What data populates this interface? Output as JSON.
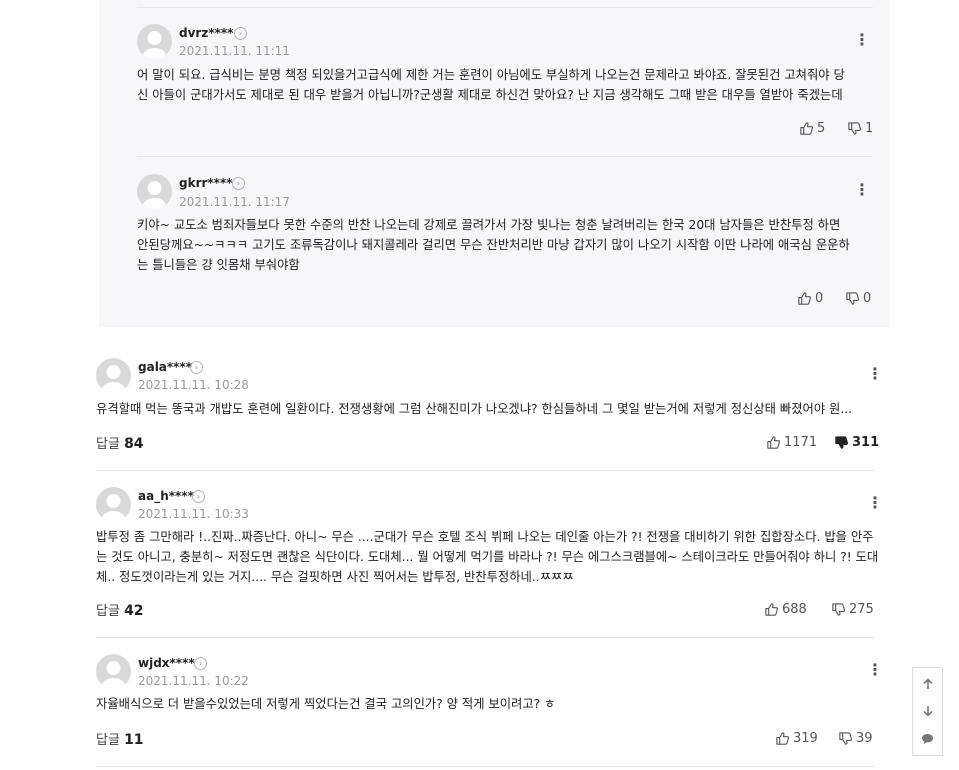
{
  "replies": [
    {
      "username": "dvrz****",
      "date": "2021.11.11. 11:11",
      "lines": [
        "어 말이 되요. 급식비는 분명 책정 되있을거고급식에 제한 거는 훈련이 아님에도 부실하게 나오는건 문제라고 봐야죠. 잘못된건 고쳐줘야 당",
        "신 아들이 군대가서도 제대로 된 대우 받을거 아닙니까?군생활 제대로 하신건 맞아요? 난 지금 생각해도 그때 받은 대우들 열받아 죽겠는데"
      ],
      "likes": "5",
      "dislikes": "1"
    },
    {
      "username": "gkrr****",
      "date": "2021.11.11. 11:17",
      "lines": [
        "키야~ 교도소 범죄자들보다 못한 수준의 반찬 나오는데 강제로 끌려가서 가장 빛나는 청춘 날려버리는 한국 20대 남자들은 반찬투정 하면",
        "안된당께요~~ㅋㅋㅋ 고기도 조류독감이나 돼지콜레라 걸리면 무슨 잔반처리반 마냥 갑자기 많이 나오기 시작함 이딴 나라에 애국심 운운하",
        "는 틀니들은 걍 잇몸채 부숴야함"
      ],
      "likes": "0",
      "dislikes": "0"
    }
  ],
  "comments": [
    {
      "username": "gala****",
      "date": "2021.11.11. 10:28",
      "lines": [
        "유격할때 먹는 똥국과 개밥도 훈련에 일환이다. 전쟁생황에 그럼 산해진미가 나오겠냐? 한심들하네 그 몇일 받는거에 저렇게 정신상태 빠졌어야 원..."
      ],
      "reply_label": "답글",
      "reply_count": "84",
      "likes": "1171",
      "dislikes": "311"
    },
    {
      "username": "aa_h****",
      "date": "2021.11.11. 10:33",
      "lines": [
        "밥투정 좀 그만해라 !..진짜..짜증난다. 아니~ 무슨 ....군대가 무슨 호텔 조식 뷔페 나오는 데인줄 아는가 ?! 전쟁을 대비하기 위한 집합장소다. 밥을 안주",
        "는 것도 아니고, 충분히~ 저정도면 괜찮은 식단이다. 도대체... 뭘 어떻게 먹기를 바라나 ?! 무슨 에그스크램블에~ 스테이크라도 만들어줘야 하니 ?! 도대",
        "체.. 정도껏이라는게 있는 거지.... 무슨 걸핏하면 사진 찍어서는 밥투정, 반찬투정하네..ㅉㅉㅉ"
      ],
      "reply_label": "답글",
      "reply_count": "42",
      "likes": "688",
      "dislikes": "275"
    },
    {
      "username": "wjdx****",
      "date": "2021.11.11. 10:22",
      "lines": [
        "자율배식으로 더 받을수있었는데 저렇게 찍었다는건 결국 고의인가? 양 적게 보이려고? ㅎ"
      ],
      "reply_label": "답글",
      "reply_count": "11",
      "likes": "319",
      "dislikes": "39"
    }
  ],
  "icons": {
    "avatar": "default-avatar-icon",
    "profile_link": "chevron-right-icon",
    "more": "more-vertical-icon",
    "like": "thumbs-up-icon",
    "dislike": "thumbs-down-icon",
    "scroll_up": "arrow-up-icon",
    "scroll_down": "arrow-down-icon",
    "comment": "comment-bubble-icon"
  },
  "colors": {
    "reply_background": "#f7f7f9",
    "text": "#222222",
    "date": "#9a9a9a",
    "divider": "#e8e8e8"
  }
}
